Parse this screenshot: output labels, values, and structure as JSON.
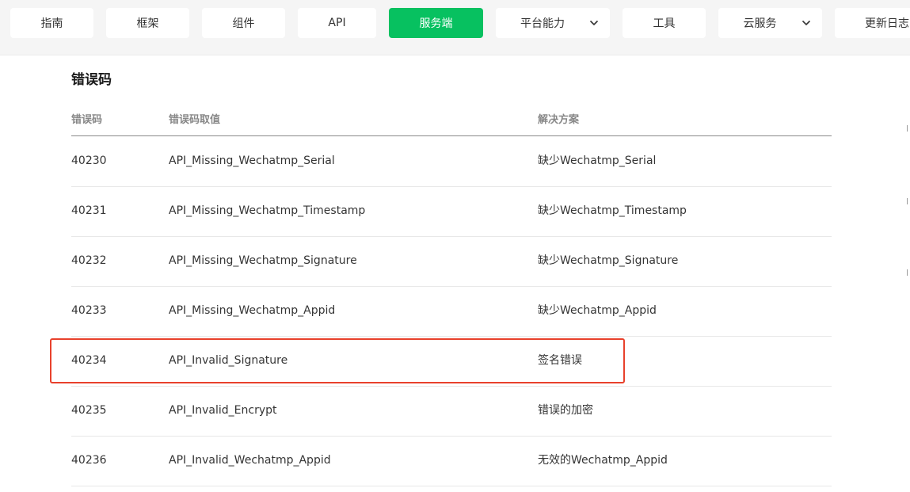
{
  "nav": {
    "items": [
      {
        "label": "指南",
        "active": false,
        "dropdown": false
      },
      {
        "label": "框架",
        "active": false,
        "dropdown": false
      },
      {
        "label": "组件",
        "active": false,
        "dropdown": false
      },
      {
        "label": "API",
        "active": false,
        "dropdown": false
      },
      {
        "label": "服务端",
        "active": true,
        "dropdown": false
      },
      {
        "label": "平台能力",
        "active": false,
        "dropdown": true
      },
      {
        "label": "工具",
        "active": false,
        "dropdown": false
      },
      {
        "label": "云服务",
        "active": false,
        "dropdown": true
      },
      {
        "label": "更新日志",
        "active": false,
        "dropdown": false
      }
    ]
  },
  "main": {
    "section_title": "错误码",
    "table": {
      "headers": [
        "错误码",
        "错误码取值",
        "解决方案"
      ],
      "rows": [
        {
          "code": "40230",
          "value": "API_Missing_Wechatmp_Serial",
          "solution": "缺少Wechatmp_Serial",
          "highlighted": false
        },
        {
          "code": "40231",
          "value": "API_Missing_Wechatmp_Timestamp",
          "solution": "缺少Wechatmp_Timestamp",
          "highlighted": false
        },
        {
          "code": "40232",
          "value": "API_Missing_Wechatmp_Signature",
          "solution": "缺少Wechatmp_Signature",
          "highlighted": false
        },
        {
          "code": "40233",
          "value": "API_Missing_Wechatmp_Appid",
          "solution": "缺少Wechatmp_Appid",
          "highlighted": false
        },
        {
          "code": "40234",
          "value": "API_Invalid_Signature",
          "solution": "签名错误",
          "highlighted": true
        },
        {
          "code": "40235",
          "value": "API_Invalid_Encrypt",
          "solution": "错误的加密",
          "highlighted": false
        },
        {
          "code": "40236",
          "value": "API_Invalid_Wechatmp_Appid",
          "solution": "无效的Wechatmp_Appid",
          "highlighted": false
        }
      ]
    }
  },
  "colors": {
    "accent": "#07c160",
    "highlight_border": "#e8412c",
    "topbar_bg": "#f5f5f5"
  }
}
